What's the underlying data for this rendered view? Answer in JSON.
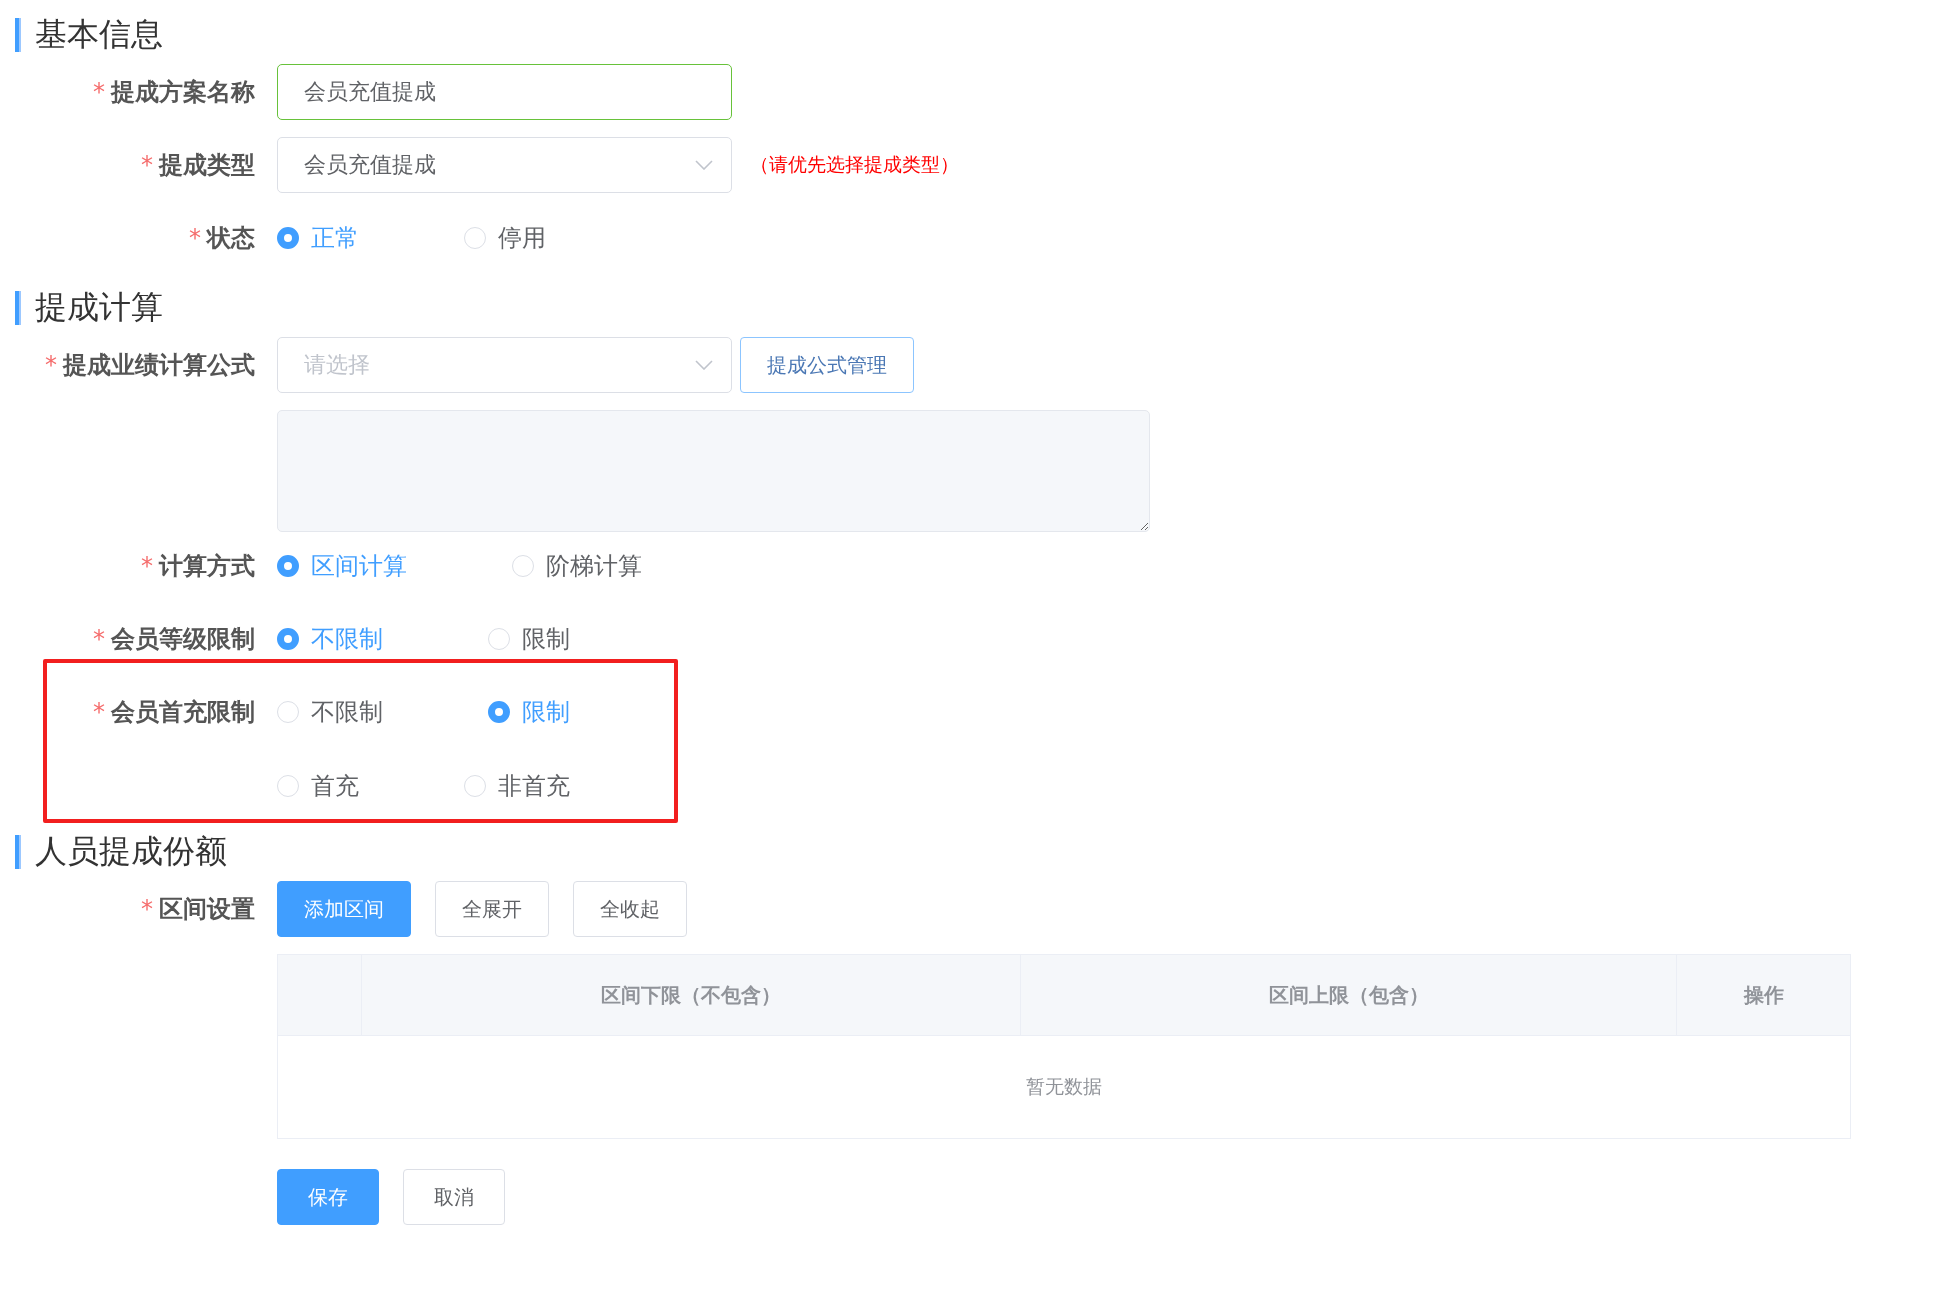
{
  "sections": [
    {
      "title": "基本信息",
      "fields": [
        {
          "kind": "input",
          "label": "提成方案名称",
          "required_mark": "*",
          "value": "会员充值提成",
          "focused": true
        },
        {
          "kind": "select",
          "label": "提成类型",
          "required_mark": "*",
          "value": "会员充值提成",
          "hint": "（请优先选择提成类型）"
        },
        {
          "kind": "radio",
          "label": "状态",
          "required_mark": "*",
          "option_rows": [
            [
              {
                "label": "正常",
                "selected": true
              },
              {
                "label": "停用",
                "selected": false
              }
            ]
          ]
        }
      ]
    },
    {
      "title": "提成计算",
      "fields": [
        {
          "kind": "select",
          "label": "提成业绩计算公式",
          "required_mark": "*",
          "placeholder": "请选择",
          "button": "提成公式管理"
        },
        {
          "kind": "textarea"
        },
        {
          "kind": "radio",
          "label": "计算方式",
          "required_mark": "*",
          "option_rows": [
            [
              {
                "label": "区间计算",
                "selected": true
              },
              {
                "label": "阶梯计算",
                "selected": false
              }
            ]
          ]
        },
        {
          "kind": "radio",
          "label": "会员等级限制",
          "required_mark": "*",
          "option_rows": [
            [
              {
                "label": "不限制",
                "selected": true
              },
              {
                "label": "限制",
                "selected": false
              }
            ]
          ]
        },
        {
          "kind": "radio",
          "label": "会员首充限制",
          "required_mark": "*",
          "highlighted": true,
          "option_rows": [
            [
              {
                "label": "不限制",
                "selected": false
              },
              {
                "label": "限制",
                "selected": true
              }
            ],
            [
              {
                "label": "首充",
                "selected": false
              },
              {
                "label": "非首充",
                "selected": false
              }
            ]
          ]
        }
      ]
    },
    {
      "title": "人员提成份额",
      "fields": [
        {
          "kind": "table",
          "label": "区间设置",
          "required_mark": "*",
          "buttons": [
            {
              "label": "添加区间",
              "primary": true
            },
            {
              "label": "全展开",
              "primary": false
            },
            {
              "label": "全收起",
              "primary": false
            }
          ],
          "columns": [
            "区间下限（不包含）",
            "区间上限（包含）",
            "操作"
          ],
          "empty_text": "暂无数据"
        }
      ]
    }
  ],
  "actions": [
    {
      "label": "保存",
      "primary": true
    },
    {
      "label": "取消",
      "primary": false
    }
  ]
}
